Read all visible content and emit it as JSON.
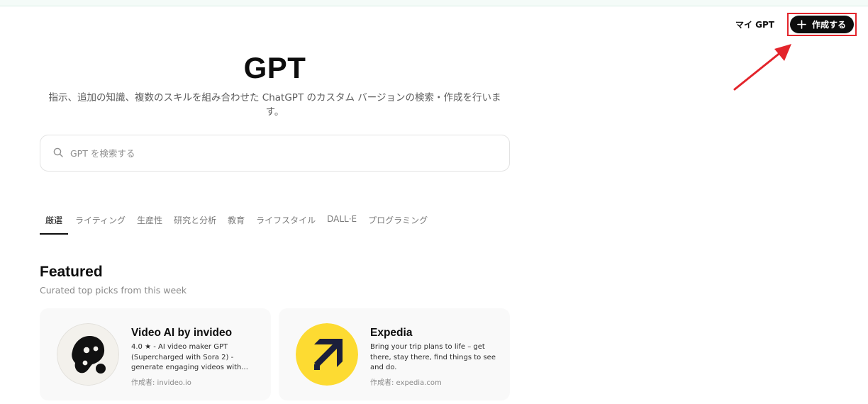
{
  "header": {
    "my_gpt_label": "マイ GPT",
    "create_label": "作成する",
    "create_icon": "plus-icon",
    "annotation_color": "#e3242b"
  },
  "main": {
    "title": "GPT",
    "subtitle": "指示、追加の知識、複数のスキルを組み合わせた ChatGPT のカスタム バージョンの検索・作成を行います。",
    "search": {
      "placeholder": "GPT を検索する",
      "icon": "search-icon"
    },
    "tabs": [
      {
        "label": "厳選",
        "active": true
      },
      {
        "label": "ライティング",
        "active": false
      },
      {
        "label": "生産性",
        "active": false
      },
      {
        "label": "研究と分析",
        "active": false
      },
      {
        "label": "教育",
        "active": false
      },
      {
        "label": "ライフスタイル",
        "active": false
      },
      {
        "label": "DALL·E",
        "active": false
      },
      {
        "label": "プログラミング",
        "active": false
      }
    ],
    "featured": {
      "title": "Featured",
      "subtitle": "Curated top picks from this week",
      "cards": [
        {
          "title": "Video AI by invideo",
          "description": "4.0 ★ - AI video maker GPT (Supercharged with Sora 2) - generate engaging videos with...",
          "author": "作成者: invideo.io",
          "logo": "invideo-logo"
        },
        {
          "title": "Expedia",
          "description": "Bring your trip plans to life – get there, stay there, find things to see and do.",
          "author": "作成者: expedia.com",
          "logo": "expedia-logo",
          "logo_color": "#fddb32"
        }
      ]
    }
  }
}
